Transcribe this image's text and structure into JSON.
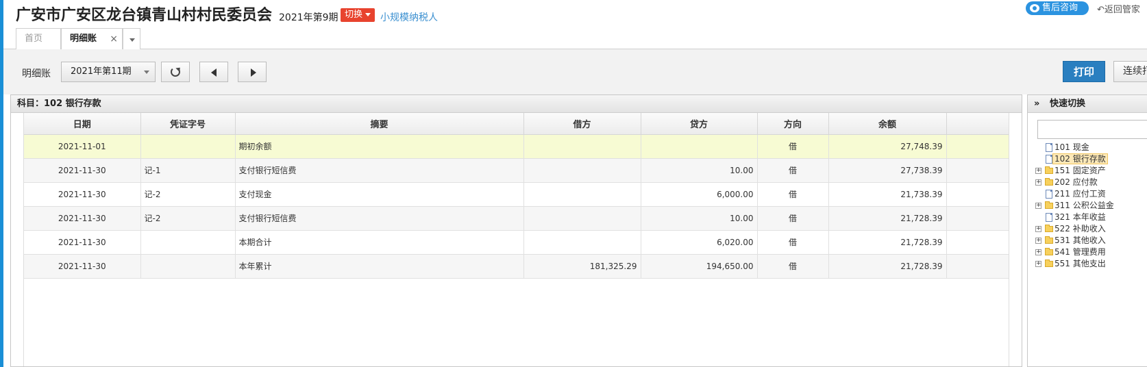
{
  "header": {
    "org_name": "广安市广安区龙台镇青山村村民委员会",
    "period": "2021年第9期",
    "switch_label": "切换",
    "taxpayer_type": "小规模纳税人",
    "consult_label": "售后咨询",
    "back_label": "返回管家"
  },
  "tabs": [
    {
      "label": "首页"
    },
    {
      "label": "明细账",
      "active": true
    }
  ],
  "toolbar": {
    "label": "明细账",
    "period_select": "2021年第11期",
    "print_label": "打印",
    "continuous_print_label": "连续打"
  },
  "ledger": {
    "subject": "科目：102  银行存款",
    "columns": [
      "日期",
      "凭证字号",
      "摘要",
      "借方",
      "贷方",
      "方向",
      "余额"
    ],
    "rows": [
      {
        "date": "2021-11-01",
        "voucher": "",
        "summary": "期初余额",
        "debit": "",
        "credit": "",
        "direction": "借",
        "balance": "27,748.39"
      },
      {
        "date": "2021-11-30",
        "voucher": "记-1",
        "summary": "支付银行短信费",
        "debit": "",
        "credit": "10.00",
        "direction": "借",
        "balance": "27,738.39"
      },
      {
        "date": "2021-11-30",
        "voucher": "记-2",
        "summary": "支付现金",
        "debit": "",
        "credit": "6,000.00",
        "direction": "借",
        "balance": "21,738.39"
      },
      {
        "date": "2021-11-30",
        "voucher": "记-2",
        "summary": "支付银行短信费",
        "debit": "",
        "credit": "10.00",
        "direction": "借",
        "balance": "21,728.39"
      },
      {
        "date": "2021-11-30",
        "voucher": "",
        "summary": "本期合计",
        "debit": "",
        "credit": "6,020.00",
        "direction": "借",
        "balance": "21,728.39"
      },
      {
        "date": "2021-11-30",
        "voucher": "",
        "summary": "本年累计",
        "debit": "181,325.29",
        "credit": "194,650.00",
        "direction": "借",
        "balance": "21,728.39"
      }
    ]
  },
  "quick_switch": {
    "title": "快速切换",
    "collapse_glyph": "»",
    "items": [
      {
        "label": "101 现金",
        "type": "doc",
        "expandable": false
      },
      {
        "label": "102 银行存款",
        "type": "doc",
        "expandable": false,
        "selected": true
      },
      {
        "label": "151 固定资产",
        "type": "folder",
        "expandable": true
      },
      {
        "label": "202 应付款",
        "type": "folder",
        "expandable": true
      },
      {
        "label": "211 应付工资",
        "type": "doc",
        "expandable": false
      },
      {
        "label": "311 公积公益金",
        "type": "folder",
        "expandable": true
      },
      {
        "label": "321 本年收益",
        "type": "doc",
        "expandable": false
      },
      {
        "label": "522 补助收入",
        "type": "folder",
        "expandable": true
      },
      {
        "label": "531 其他收入",
        "type": "folder",
        "expandable": true
      },
      {
        "label": "541 管理费用",
        "type": "folder",
        "expandable": true
      },
      {
        "label": "551 其他支出",
        "type": "folder",
        "expandable": true
      }
    ]
  },
  "colors": {
    "accent_blue": "#2a7fc0",
    "switch_red": "#e8432e",
    "highlight_row": "#f7fbd3",
    "left_strip": "#1a8fd6"
  }
}
